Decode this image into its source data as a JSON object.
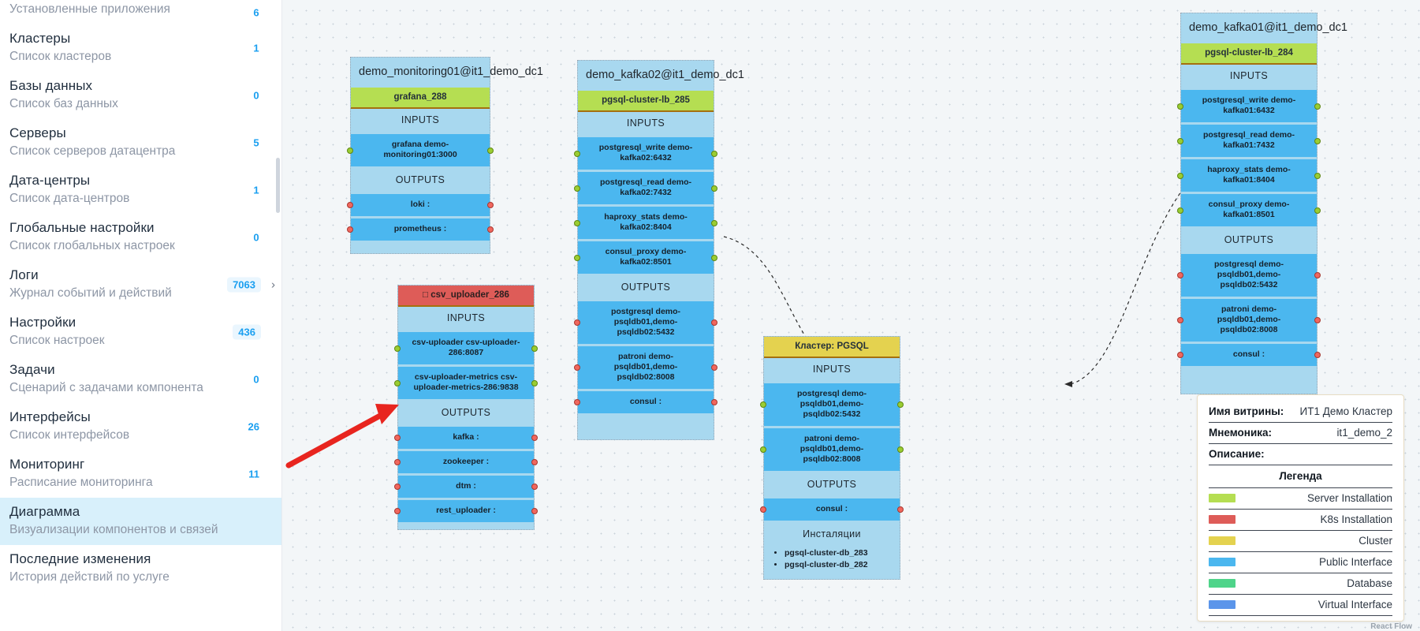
{
  "sidebar": {
    "items": [
      {
        "title": "",
        "sub": "Установленные приложения",
        "badge": "6",
        "badge_style": "plain",
        "active": false,
        "chevron": false,
        "partial": true
      },
      {
        "title": "Кластеры",
        "sub": "Список кластеров",
        "badge": "1",
        "badge_style": "plain",
        "active": false,
        "chevron": false
      },
      {
        "title": "Базы данных",
        "sub": "Список баз данных",
        "badge": "0",
        "badge_style": "plain",
        "active": false,
        "chevron": false
      },
      {
        "title": "Серверы",
        "sub": "Список серверов датацентра",
        "badge": "5",
        "badge_style": "plain",
        "active": false,
        "chevron": false
      },
      {
        "title": "Дата-центры",
        "sub": "Список дата-центров",
        "badge": "1",
        "badge_style": "plain",
        "active": false,
        "chevron": false
      },
      {
        "title": "Глобальные настройки",
        "sub": "Список глобальных настроек",
        "badge": "0",
        "badge_style": "plain",
        "active": false,
        "chevron": false
      },
      {
        "title": "Логи",
        "sub": "Журнал событий и действий",
        "badge": "7063",
        "badge_style": "chip",
        "active": false,
        "chevron": true
      },
      {
        "title": "Настройки",
        "sub": "Список настроек",
        "badge": "436",
        "badge_style": "chip",
        "active": false,
        "chevron": false
      },
      {
        "title": "Задачи",
        "sub": "Сценарий с задачами компонента",
        "badge": "0",
        "badge_style": "plain",
        "active": false,
        "chevron": false
      },
      {
        "title": "Интерфейсы",
        "sub": "Список интерфейсов",
        "badge": "26",
        "badge_style": "plain",
        "active": false,
        "chevron": false
      },
      {
        "title": "Мониторинг",
        "sub": "Расписание мониторинга",
        "badge": "11",
        "badge_style": "plain",
        "active": false,
        "chevron": false
      },
      {
        "title": "Диаграмма",
        "sub": "Визуализации компонентов и связей",
        "badge": "",
        "badge_style": "none",
        "active": true,
        "chevron": false
      },
      {
        "title": "Последние изменения",
        "sub": "История действий по услуге",
        "badge": "",
        "badge_style": "none",
        "active": false,
        "chevron": false
      }
    ]
  },
  "diagram": {
    "section_labels": {
      "inputs": "INPUTS",
      "outputs": "OUTPUTS",
      "installations": "Инсталяции"
    },
    "nodes": [
      {
        "id": "monitoring01",
        "title": "demo_monitoring01@it1_demo_dc1",
        "band": {
          "label": "grafana_288",
          "type": "server"
        },
        "inputs": [
          {
            "label": "grafana demo-monitoring01:3000",
            "left_dot": true,
            "right_dot": true
          }
        ],
        "outputs": [
          {
            "label": "loki :",
            "left_dot": true,
            "right_dot": true
          },
          {
            "label": "prometheus :",
            "left_dot": true,
            "right_dot": true
          }
        ],
        "installations": []
      },
      {
        "id": "kafka02",
        "title": "demo_kafka02@it1_demo_dc1",
        "band": {
          "label": "pgsql-cluster-lb_285",
          "type": "server"
        },
        "inputs": [
          {
            "label": "postgresql_write demo-kafka02:6432",
            "left_dot": true,
            "right_dot": true
          },
          {
            "label": "postgresql_read demo-kafka02:7432",
            "left_dot": true,
            "right_dot": true
          },
          {
            "label": "haproxy_stats demo-kafka02:8404",
            "left_dot": true,
            "right_dot": true
          },
          {
            "label": "consul_proxy demo-kafka02:8501",
            "left_dot": true,
            "right_dot": true
          }
        ],
        "outputs": [
          {
            "label": "postgresql demo-psqldb01,demo-psqldb02:5432",
            "left_dot": true,
            "right_dot": true
          },
          {
            "label": "patroni demo-psqldb01,demo-psqldb02:8008",
            "left_dot": true,
            "right_dot": true
          },
          {
            "label": "consul :",
            "left_dot": true,
            "right_dot": true
          }
        ],
        "installations": []
      },
      {
        "id": "kafka01",
        "title": "demo_kafka01@it1_demo_dc1",
        "band": {
          "label": "pgsql-cluster-lb_284",
          "type": "server"
        },
        "inputs": [
          {
            "label": "postgresql_write demo-kafka01:6432",
            "left_dot": true,
            "right_dot": true
          },
          {
            "label": "postgresql_read demo-kafka01:7432",
            "left_dot": true,
            "right_dot": true
          },
          {
            "label": "haproxy_stats demo-kafka01:8404",
            "left_dot": true,
            "right_dot": true
          },
          {
            "label": "consul_proxy demo-kafka01:8501",
            "left_dot": true,
            "right_dot": true
          }
        ],
        "outputs": [
          {
            "label": "postgresql demo-psqldb01,demo-psqldb02:5432",
            "left_dot": true,
            "right_dot": true
          },
          {
            "label": "patroni demo-psqldb01,demo-psqldb02:8008",
            "left_dot": true,
            "right_dot": true
          },
          {
            "label": "consul :",
            "left_dot": true,
            "right_dot": true
          }
        ],
        "installations": []
      },
      {
        "id": "csv_uploader",
        "title": "",
        "band": {
          "label": "csv_uploader_286",
          "type": "k8s",
          "icon": "□"
        },
        "inputs": [
          {
            "label": "csv-uploader csv-uploader-286:8087",
            "left_dot": true,
            "right_dot": true
          },
          {
            "label": "csv-uploader-metrics csv-uploader-metrics-286:9838",
            "left_dot": true,
            "right_dot": true
          }
        ],
        "outputs": [
          {
            "label": "kafka :",
            "left_dot": true,
            "right_dot": true
          },
          {
            "label": "zookeeper :",
            "left_dot": true,
            "right_dot": true
          },
          {
            "label": "dtm :",
            "left_dot": true,
            "right_dot": true
          },
          {
            "label": "rest_uploader :",
            "left_dot": true,
            "right_dot": true
          }
        ],
        "installations": []
      },
      {
        "id": "pgsql_cluster",
        "title": "",
        "band": {
          "label": "Кластер: PGSQL",
          "type": "cluster"
        },
        "inputs": [
          {
            "label": "postgresql demo-psqldb01,demo-psqldb02:5432",
            "left_dot": true,
            "right_dot": true
          },
          {
            "label": "patroni demo-psqldb01,demo-psqldb02:8008",
            "left_dot": true,
            "right_dot": true
          }
        ],
        "outputs": [
          {
            "label": "consul :",
            "left_dot": true,
            "right_dot": true
          }
        ],
        "installations": [
          "pgsql-cluster-db_283",
          "pgsql-cluster-db_282"
        ]
      }
    ]
  },
  "info_panel": {
    "rows": [
      {
        "key": "Имя витрины:",
        "value": "ИТ1 Демо Кластер"
      },
      {
        "key": "Мнемоника:",
        "value": "it1_demo_2"
      },
      {
        "key": "Описание:",
        "value": ""
      }
    ],
    "legend_title": "Легенда",
    "legend": [
      {
        "label": "Server Installation",
        "color": "#b5de52"
      },
      {
        "label": "K8s Installation",
        "color": "#de5c58"
      },
      {
        "label": "Cluster",
        "color": "#e4d24f"
      },
      {
        "label": "Public Interface",
        "color": "#4bb7ef"
      },
      {
        "label": "Database",
        "color": "#4fd48a"
      },
      {
        "label": "Virtual Interface",
        "color": "#5b95ea"
      }
    ]
  },
  "watermark": "React Flow"
}
